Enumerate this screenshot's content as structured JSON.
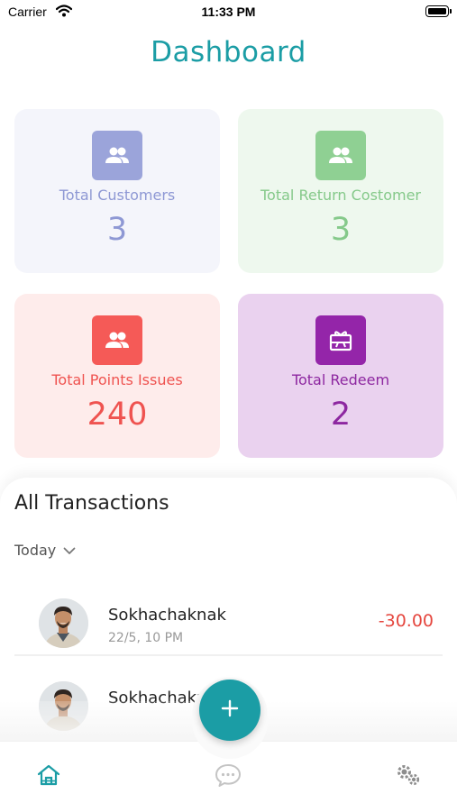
{
  "status_bar": {
    "carrier": "Carrier",
    "time": "11:33 PM"
  },
  "page": {
    "title": "Dashboard"
  },
  "stats": [
    {
      "label": "Total Customers",
      "value": "3",
      "icon": "users-icon",
      "color": "#9ba4da"
    },
    {
      "label": "Total Return Costomer",
      "value": "3",
      "icon": "users-icon",
      "color": "#8fd093"
    },
    {
      "label": "Total Points Issues",
      "value": "240",
      "icon": "users-icon",
      "color": "#f55a57"
    },
    {
      "label": "Total Redeem",
      "value": "2",
      "icon": "gift-card-icon",
      "color": "#9425a9"
    }
  ],
  "transactions": {
    "title": "All Transactions",
    "filter": "Today",
    "items": [
      {
        "name": "Sokhachaknak",
        "time": "22/5, 10 PM",
        "amount": "-30.00"
      },
      {
        "name": "Sokhachaknak",
        "time": "",
        "amount": ""
      }
    ]
  },
  "tab_bar": {
    "items": [
      "home-icon",
      "chat-icon",
      "settings-icon"
    ],
    "active": "home-icon"
  },
  "fab": {
    "icon": "plus-icon"
  },
  "colors": {
    "accent": "#1b9da5",
    "negative_amount": "#e5473f"
  }
}
